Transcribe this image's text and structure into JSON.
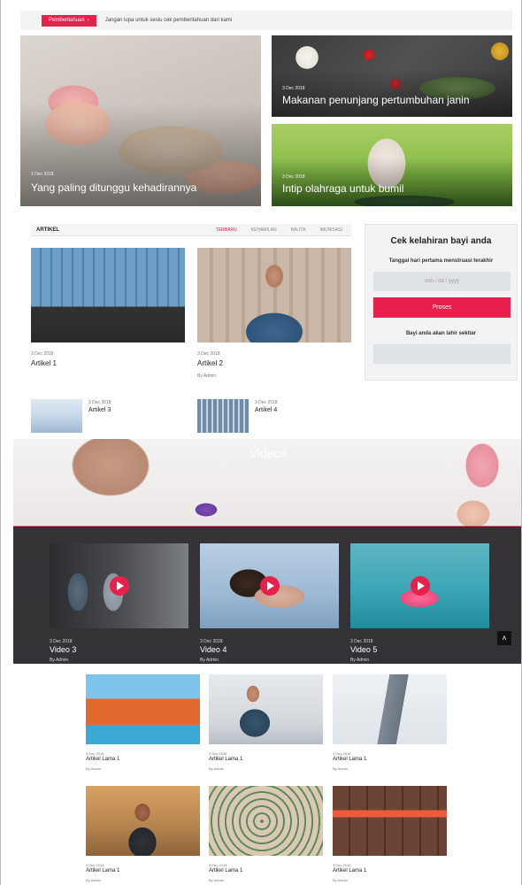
{
  "notice": {
    "button_label": "Pemberitahuan",
    "button_icon": "chevron-right-icon",
    "text": "Jangan lupa untuk sesiu cek pemberitahuan dari kami"
  },
  "hero": {
    "main": {
      "date": "3 Dec 2018",
      "title": "Yang paling ditunggu kehadirannya"
    },
    "food": {
      "date": "3 Dec 2018",
      "title": "Makanan penunjang pertumbuhan janin"
    },
    "yoga": {
      "date": "3 Dec 2018",
      "title": "Intip olahraga untuk bumil"
    }
  },
  "articles": {
    "header": "ARTIKEL",
    "tabs": [
      "TERBARU",
      "KEHAMILAN",
      "BALITA",
      "IMUNISASI"
    ],
    "active_tab": "TERBARU",
    "featured": [
      {
        "date": "3 Dec 2018",
        "title": "Artikel 1"
      },
      {
        "date": "3 Dec 2018",
        "title": "Artikel 2",
        "by": "By Admin"
      }
    ],
    "small": [
      {
        "date": "3 Dec 2018",
        "title": "Artikel 3"
      },
      {
        "date": "3 Dec 2018",
        "title": "Artikel 4"
      }
    ]
  },
  "calculator": {
    "title": "Cek kelahiran bayi anda",
    "date_label": "Tanggal hari pertama menstruasi terakhir",
    "date_placeholder": "mm / dd / yyyy",
    "button": "Proses",
    "result_label": "Bayi anda akan lahir sekitar",
    "result_value": ""
  },
  "videos": {
    "title": "Videos",
    "items": [
      {
        "date": "3 Dec 2018",
        "title": "Video 3",
        "by": "By Admin"
      },
      {
        "date": "3 Dec 2018",
        "title": "Video 4",
        "by": "By Admin"
      },
      {
        "date": "3 Dec 2018",
        "title": "Video 5",
        "by": "By Admin"
      }
    ],
    "scroll_top_icon": "chevron-up-icon"
  },
  "old_articles": [
    {
      "date": "3 Dec 2018",
      "title": "Artikel Lama 1",
      "by": "By Admin"
    },
    {
      "date": "3 Dec 2018",
      "title": "Artikel Lama 1",
      "by": "By Admin"
    },
    {
      "date": "3 Dec 2018",
      "title": "Artikel Lama 1",
      "by": "By Admin"
    },
    {
      "date": "3 Dec 2018",
      "title": "Artikel Lama 1",
      "by": "By Admin"
    },
    {
      "date": "3 Dec 2018",
      "title": "Artikel Lama 1",
      "by": "By Admin"
    },
    {
      "date": "3 Dec 2018",
      "title": "Artikel Lama 1",
      "by": "By Admin"
    }
  ],
  "colors": {
    "accent": "#e8204c",
    "panel": "#f1f3f5"
  }
}
